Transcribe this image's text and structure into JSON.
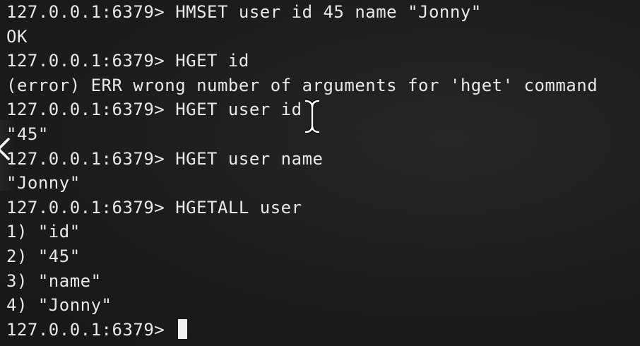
{
  "terminal": {
    "lines": [
      "127.0.0.1:6379> HMSET user id 45 name \"Jonny\"",
      "OK",
      "127.0.0.1:6379> HGET id",
      "(error) ERR wrong number of arguments for 'hget' command",
      "127.0.0.1:6379> HGET user id",
      "\"45\"",
      "127.0.0.1:6379> HGET user name",
      "\"Jonny\"",
      "127.0.0.1:6379> HGETALL user",
      "1) \"id\"",
      "2) \"45\"",
      "3) \"name\"",
      "4) \"Jonny\""
    ],
    "prompt": "127.0.0.1:6379> "
  },
  "icons": {
    "text_cursor": "i-beam-cursor-icon",
    "back": "chevron-left-icon"
  },
  "colors": {
    "background": "#1c1c1c",
    "text": "#e8e8e8",
    "cursor": "#f2f2f2"
  }
}
